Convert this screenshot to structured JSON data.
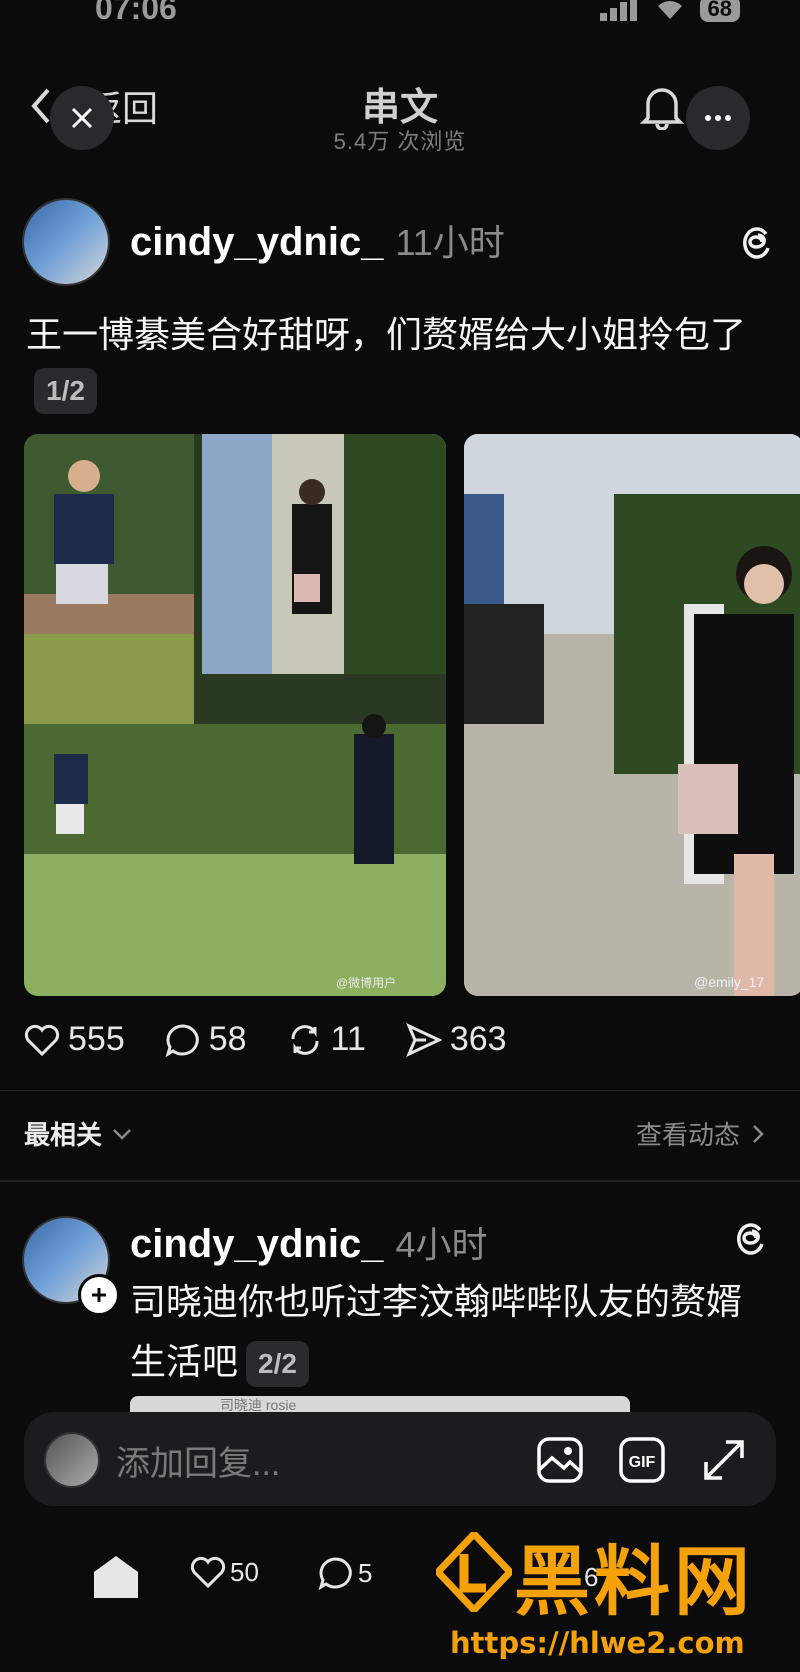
{
  "status_bar": {
    "time": "07:06",
    "battery": "68"
  },
  "header": {
    "back_label": "返回",
    "title": "串文",
    "subtitle": "5.4万 次浏览"
  },
  "post": {
    "username": "cindy_ydnic_",
    "time": "11小时",
    "text": "王一博綦美合好甜呀，们赘婿给大小姐拎包了",
    "page": "1/2",
    "photo_caption_left": "@微博用户",
    "photo_caption_right": "@emily_17",
    "stats": {
      "likes": "555",
      "comments": "58",
      "reposts": "11",
      "shares": "363"
    }
  },
  "sort": {
    "label": "最相关",
    "view_activity": "查看动态"
  },
  "reply": {
    "username": "cindy_ydnic_",
    "time": "4小时",
    "text": "司晓迪你也听过李汶翰哔哔队友的赘婿生活吧",
    "page": "2/2",
    "preview_text": "司晓迪 rosie"
  },
  "reply_input": {
    "placeholder": "添加回复..."
  },
  "bottom_bar": {
    "likes": "50",
    "comments": "5",
    "shares": "6"
  },
  "watermark": {
    "title": "黑料网",
    "url": "https://hlwe2.com"
  },
  "colors": {
    "background": "#0b0b0c",
    "accent_watermark": "#f5a20a"
  }
}
